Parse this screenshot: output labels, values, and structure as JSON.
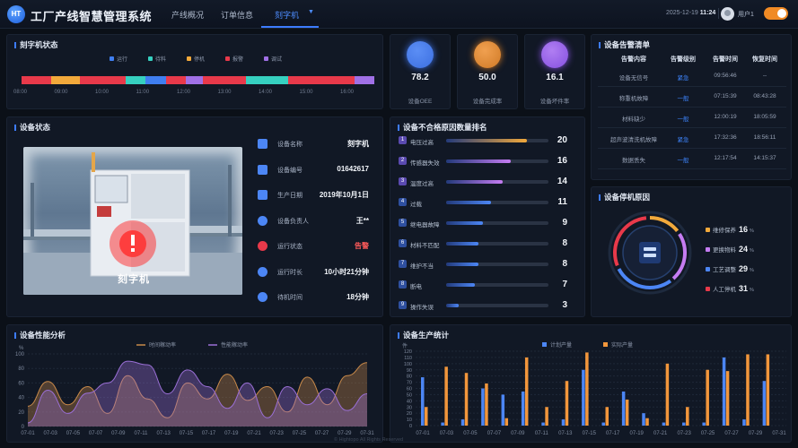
{
  "header": {
    "title": "工厂产线智慧管理系统",
    "logo_text": "HT",
    "nav": [
      "产线概况",
      "订单信息",
      "刻字机"
    ],
    "active_nav": "刻字机",
    "date": "2025-12-19",
    "time": "11:24",
    "user": "用户1"
  },
  "machine_status": {
    "title": "刻字机状态",
    "legend": [
      {
        "label": "运行",
        "color": "#3f7ef0"
      },
      {
        "label": "待料",
        "color": "#36d0c0"
      },
      {
        "label": "停机",
        "color": "#f2a93b"
      },
      {
        "label": "报警",
        "color": "#e8394a"
      },
      {
        "label": "调试",
        "color": "#a070e6"
      }
    ],
    "segments": [
      {
        "state": "报警",
        "color": "#e8394a",
        "share": 0.085
      },
      {
        "state": "停机",
        "color": "#f2a93b",
        "share": 0.08
      },
      {
        "state": "报警",
        "color": "#e8394a",
        "share": 0.09
      },
      {
        "state": "报警",
        "color": "#e8394a",
        "share": 0.04
      },
      {
        "state": "待料",
        "color": "#36d0c0",
        "share": 0.055
      },
      {
        "state": "运行",
        "color": "#3f7ef0",
        "share": 0.06
      },
      {
        "state": "报警",
        "color": "#e8394a",
        "share": 0.055
      },
      {
        "state": "调试",
        "color": "#a070e6",
        "share": 0.05
      },
      {
        "state": "报警",
        "color": "#e8394a",
        "share": 0.12
      },
      {
        "state": "待料",
        "color": "#36d0c0",
        "share": 0.12
      },
      {
        "state": "报警",
        "color": "#e8394a",
        "share": 0.19
      },
      {
        "state": "调试",
        "color": "#a070e6",
        "share": 0.055
      }
    ],
    "ticks": [
      "08:00",
      "09:00",
      "10:00",
      "11:00",
      "12:00",
      "13:00",
      "14:00",
      "15:00",
      "16:00"
    ]
  },
  "kpis": [
    {
      "value": "78.2",
      "label": "设备OEE",
      "color": "#5b8ef5",
      "glow": "#3c6fe0"
    },
    {
      "value": "50.0",
      "label": "设备完成率",
      "color": "#f0a050",
      "glow": "#d07a26"
    },
    {
      "value": "16.1",
      "label": "设备坏件率",
      "color": "#b07ef2",
      "glow": "#8550e0"
    }
  ],
  "alarms": {
    "title": "设备告警清单",
    "columns": [
      "告警内容",
      "告警级别",
      "告警时间",
      "恢复时间"
    ],
    "rows": [
      [
        "设备无信号",
        "紧急",
        "09:56:46",
        "--"
      ],
      [
        "称重机故障",
        "一般",
        "07:15:39",
        "08:43:28"
      ],
      [
        "材料缺少",
        "一般",
        "12:00:19",
        "18:05:59"
      ],
      [
        "超声波清洗机故障",
        "紧急",
        "17:32:36",
        "18:56:11"
      ],
      [
        "数据丢失",
        "一般",
        "12:17:54",
        "14:15:37"
      ]
    ]
  },
  "device": {
    "title": "设备状态",
    "scene_label": "刻字机",
    "info": [
      {
        "label": "设备名称",
        "value": "刻字机",
        "icon": "diamond-icon",
        "color": "#4c86f5"
      },
      {
        "label": "设备编号",
        "value": "01642617",
        "icon": "layers-icon",
        "color": "#4c86f5"
      },
      {
        "label": "生产日期",
        "value": "2019年10月1日",
        "icon": "calendar-icon",
        "color": "#4c86f5"
      },
      {
        "label": "设备负责人",
        "value": "王**",
        "icon": "person-icon",
        "color": "#4c86f5"
      },
      {
        "label": "运行状态",
        "value": "告警",
        "icon": "alert-icon",
        "color": "#e8394a"
      },
      {
        "label": "运行时长",
        "value": "10小时21分钟",
        "icon": "clock-icon",
        "color": "#4c86f5"
      },
      {
        "label": "待机时间",
        "value": "18分钟",
        "icon": "timer-icon",
        "color": "#4c86f5"
      }
    ]
  },
  "ranking": {
    "title": "设备不合格原因数量排名",
    "items": [
      {
        "rank": "1",
        "label": "电压过高",
        "value": 20,
        "color": "#f2a93b"
      },
      {
        "rank": "2",
        "label": "传感器失效",
        "value": 16,
        "color": "#c57cf2"
      },
      {
        "rank": "3",
        "label": "温度过高",
        "value": 14,
        "color": "#c57cf2"
      },
      {
        "rank": "4",
        "label": "过载",
        "value": 11,
        "color": "#4c86f5"
      },
      {
        "rank": "5",
        "label": "继电器故障",
        "value": 9,
        "color": "#4c86f5"
      },
      {
        "rank": "6",
        "label": "材料不匹配",
        "value": 8,
        "color": "#4c86f5"
      },
      {
        "rank": "7",
        "label": "维护不当",
        "value": 8,
        "color": "#4c86f5"
      },
      {
        "rank": "8",
        "label": "断电",
        "value": 7,
        "color": "#4c86f5"
      },
      {
        "rank": "9",
        "label": "操作失误",
        "value": 3,
        "color": "#4c86f5"
      }
    ]
  },
  "stop_reasons": {
    "title": "设备停机原因",
    "items": [
      {
        "label": "维修保养",
        "value": "16",
        "unit": "%",
        "color": "#f2a93b"
      },
      {
        "label": "更换物料",
        "value": "24",
        "unit": "%",
        "color": "#c57cf2"
      },
      {
        "label": "工艺调整",
        "value": "29",
        "unit": "%",
        "color": "#4c86f5"
      },
      {
        "label": "人工停机",
        "value": "31",
        "unit": "%",
        "color": "#e8394a"
      }
    ]
  },
  "performance": {
    "title": "设备性能分析",
    "chart_data": {
      "type": "area",
      "ylabel": "%",
      "ylim": [
        0,
        100
      ],
      "yticks": [
        0,
        20,
        40,
        60,
        80,
        100
      ],
      "x": [
        "07-01",
        "07-03",
        "07-05",
        "07-07",
        "07-09",
        "07-11",
        "07-13",
        "07-15",
        "07-17",
        "07-19",
        "07-21",
        "07-23",
        "07-25",
        "07-27",
        "07-29",
        "07-31"
      ],
      "series": [
        {
          "name": "时间稼动率",
          "color": "#c98a4a",
          "values": [
            28,
            62,
            30,
            55,
            18,
            70,
            38,
            12,
            60,
            38,
            72,
            36,
            55,
            20,
            68,
            30,
            70,
            88
          ]
        },
        {
          "name": "性能稼动率",
          "color": "#9a6fd6",
          "values": [
            5,
            50,
            18,
            46,
            60,
            90,
            85,
            45,
            78,
            55,
            25,
            60,
            12,
            55,
            30,
            52,
            22,
            45
          ]
        }
      ]
    }
  },
  "production": {
    "title": "设备生产统计",
    "chart_data": {
      "type": "bar",
      "ylabel": "件",
      "ylim": [
        0,
        120
      ],
      "yticks": [
        0,
        10,
        20,
        30,
        40,
        50,
        60,
        70,
        80,
        90,
        100,
        110,
        120
      ],
      "x": [
        "07-01",
        "07-03",
        "07-05",
        "07-07",
        "07-09",
        "07-11",
        "07-13",
        "07-15",
        "07-17",
        "07-19",
        "07-21",
        "07-23",
        "07-25",
        "07-27",
        "07-29",
        "07-31"
      ],
      "series": [
        {
          "name": "计划产量",
          "color": "#4c86f5",
          "values": [
            78,
            5,
            10,
            60,
            50,
            55,
            5,
            10,
            90,
            5,
            55,
            20,
            5,
            5,
            5,
            110,
            10,
            72
          ]
        },
        {
          "name": "实际产量",
          "color": "#f2963b",
          "values": [
            30,
            95,
            85,
            68,
            12,
            110,
            30,
            72,
            118,
            30,
            42,
            12,
            100,
            30,
            90,
            88,
            115,
            115
          ]
        }
      ]
    }
  },
  "footer": "© Hightopo All Rights Reserved"
}
